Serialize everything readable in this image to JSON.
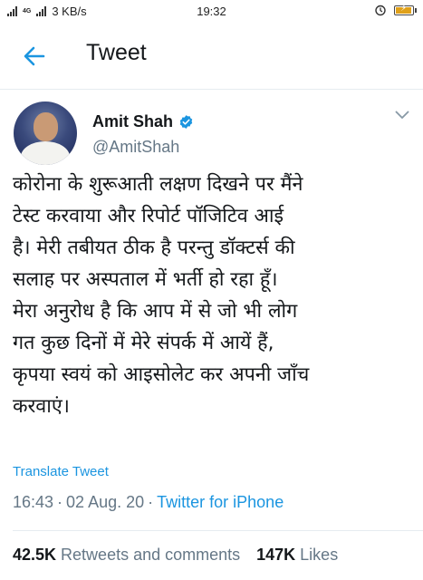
{
  "status_bar": {
    "network_speed": "3 KB/s",
    "time": "19:32"
  },
  "header": {
    "title": "Tweet"
  },
  "author": {
    "name": "Amit Shah",
    "handle": "@AmitShah"
  },
  "tweet": {
    "lines": [
      "कोरोना के शुरूआती लक्षण दिखने पर मैंने",
      "टेस्ट करवाया और रिपोर्ट पॉजिटिव आई",
      "है। मेरी तबीयत ठीक है परन्तु डॉक्टर्स की",
      "सलाह पर अस्पताल में भर्ती हो रहा हूँ।",
      "मेरा अनुरोध है कि आप में से जो भी लोग",
      "गत कुछ दिनों में मेरे संपर्क में आयें हैं,",
      "कृपया स्वयं को आइसोलेट कर अपनी जाँच",
      "करवाएं।"
    ],
    "translate_label": "Translate Tweet",
    "time": "16:43",
    "separator": "·",
    "date": "02 Aug. 20",
    "source": "Twitter for iPhone"
  },
  "stats": {
    "retweets_count": "42.5K",
    "retweets_label": "Retweets and comments",
    "likes_count": "147K",
    "likes_label": "Likes"
  },
  "colors": {
    "accent": "#1b95e0",
    "text": "#14171a",
    "muted": "#657786",
    "battery": "#e0a11a"
  }
}
